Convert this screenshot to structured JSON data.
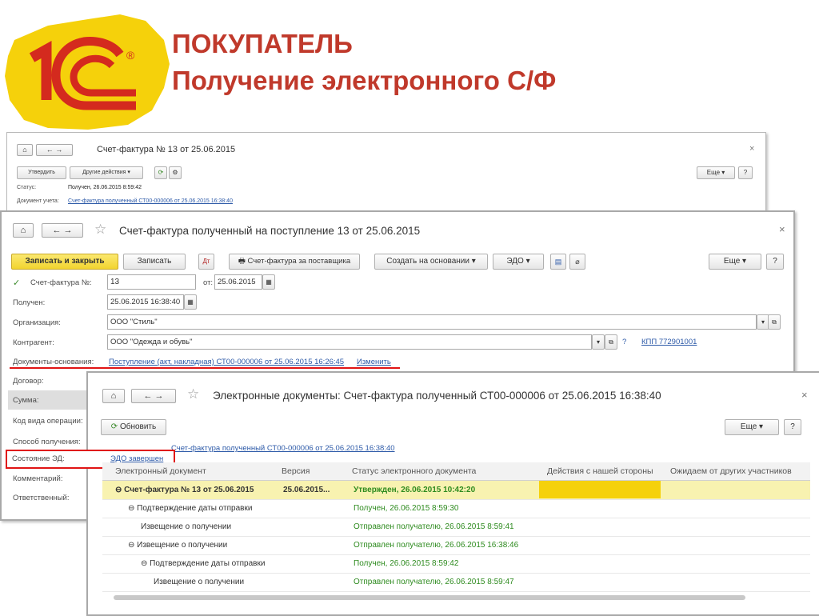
{
  "slide": {
    "title_line1": "ПОКУПАТЕЛЬ",
    "title_line2": "Получение электронного С/Ф",
    "brand_colors": {
      "title": "#c0392b",
      "logo_red": "#d42a1e",
      "logo_yellow": "#f5d10b"
    },
    "logo_mark": "®"
  },
  "win1": {
    "title": "Счет-фактура № 13 от 25.06.2015",
    "approve_btn": "Утвердить",
    "other_actions_btn": "Другие действия",
    "more_btn": "Еще",
    "help_btn": "?",
    "status_label": "Статус:",
    "status_value": "Получен, 26.06.2015 8:59:42",
    "doc_label": "Документ учета:",
    "doc_link": "Счет-фактура полученный СТ00-000006 от 25.06.2015 16:38:40",
    "close": "×"
  },
  "win2": {
    "title": "Счет-фактура полученный на поступление 13 от 25.06.2015",
    "save_close_btn": "Записать и закрыть",
    "save_btn": "Записать",
    "supplier_sf_btn": "Счет-фактура за поставщика",
    "create_based_btn": "Создать на основании",
    "edo_btn": "ЭДО",
    "more_btn": "Еще",
    "help_btn": "?",
    "close": "×",
    "sf_no_label": "Счет-фактура №:",
    "sf_no_value": "13",
    "from_label": "от:",
    "from_value": "25.06.2015",
    "received_label": "Получен:",
    "received_value": "25.06.2015 16:38:40",
    "org_label": "Организация:",
    "org_value": "ООО \"Стиль\"",
    "contragent_label": "Контрагент:",
    "contragent_value": "ООО \"Одежда и обувь\"",
    "help_q": "?",
    "kpp_link": "КПП 772901001",
    "basis_label": "Документы-основания:",
    "basis_link": "Поступление (акт, накладная) СТ00-000006 от 25.06.2015 16:26:45",
    "change_link": "Изменить",
    "contract_label": "Договор:",
    "sum_label": "Сумма:",
    "op_code_label": "Код вида операции:",
    "receive_method_label": "Способ получения:",
    "ed_state_label": "Состояние ЭД:",
    "ed_state_link": "ЭДО завершен",
    "comment_label": "Комментарий:",
    "responsible_label": "Ответственный:"
  },
  "win3": {
    "title": "Электронные документы: Счет-фактура полученный СТ00-000006 от 25.06.2015 16:38:40",
    "refresh_btn": "Обновить",
    "more_btn": "Еще",
    "help_btn": "?",
    "close": "×",
    "ref_link_partial": "Счет-фактура полученный СТ00-000006 от 25.06.2015 16:38:40",
    "columns": [
      "Электронный документ",
      "Версия",
      "Статус электронного документа",
      "Действия с нашей стороны",
      "Ожидаем от других участников"
    ],
    "rows": [
      {
        "doc": "Счет-фактура № 13 от 25.06.2015",
        "toggle": "⊖",
        "level": 0,
        "version": "25.06.2015...",
        "status": "Утвержден, 26.06.2015 10:42:20",
        "bold": true
      },
      {
        "doc": "Подтверждение даты отправки",
        "toggle": "⊖",
        "level": 1,
        "version": "",
        "status": "Получен, 26.06.2015 8:59:30",
        "bold": false
      },
      {
        "doc": "Извещение о получении",
        "toggle": "",
        "level": 2,
        "version": "",
        "status": "Отправлен получателю, 26.06.2015 8:59:41",
        "bold": false
      },
      {
        "doc": "Извещение о получении",
        "toggle": "⊖",
        "level": 1,
        "version": "",
        "status": "Отправлен получателю, 26.06.2015 16:38:46",
        "bold": false
      },
      {
        "doc": "Подтверждение даты отправки",
        "toggle": "⊖",
        "level": 2,
        "version": "",
        "status": "Получен, 26.06.2015 8:59:42",
        "bold": false
      },
      {
        "doc": "Извещение о получении",
        "toggle": "",
        "level": 3,
        "version": "",
        "status": "Отправлен получателю, 26.06.2015 8:59:47",
        "bold": false
      }
    ]
  }
}
